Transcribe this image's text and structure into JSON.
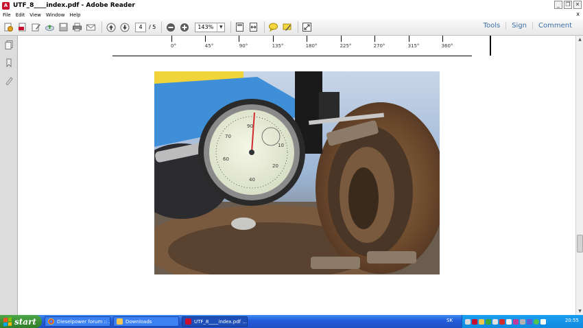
{
  "window": {
    "title": "UTF_8____index.pdf - Adobe Reader"
  },
  "menu": {
    "items": [
      "File",
      "Edit",
      "View",
      "Window",
      "Help"
    ],
    "close_doc": "x"
  },
  "toolbar": {
    "page_current": "4",
    "page_total": "/ 5",
    "zoom": "143%",
    "links": {
      "tools": "Tools",
      "sign": "Sign",
      "comment": "Comment"
    }
  },
  "document": {
    "axis_labels": [
      "0°",
      "45°",
      "90°",
      "135°",
      "180°",
      "225°",
      "270°",
      "315°",
      "360°"
    ]
  },
  "taskbar": {
    "start_label": "start",
    "tasks": [
      {
        "label": "Dieselpower forum :: ...",
        "icon": "chrome-icon"
      },
      {
        "label": "Downloads",
        "icon": "folder-icon"
      },
      {
        "label": "UTF_8____index.pdf ...",
        "icon": "pdf-icon"
      }
    ],
    "language": "SK",
    "clock": "20:55"
  },
  "colors": {
    "taskbar_blue": "#245edb",
    "start_green": "#3b8f35",
    "link_blue": "#3a6ea5",
    "pdf_red": "#c8102e"
  }
}
